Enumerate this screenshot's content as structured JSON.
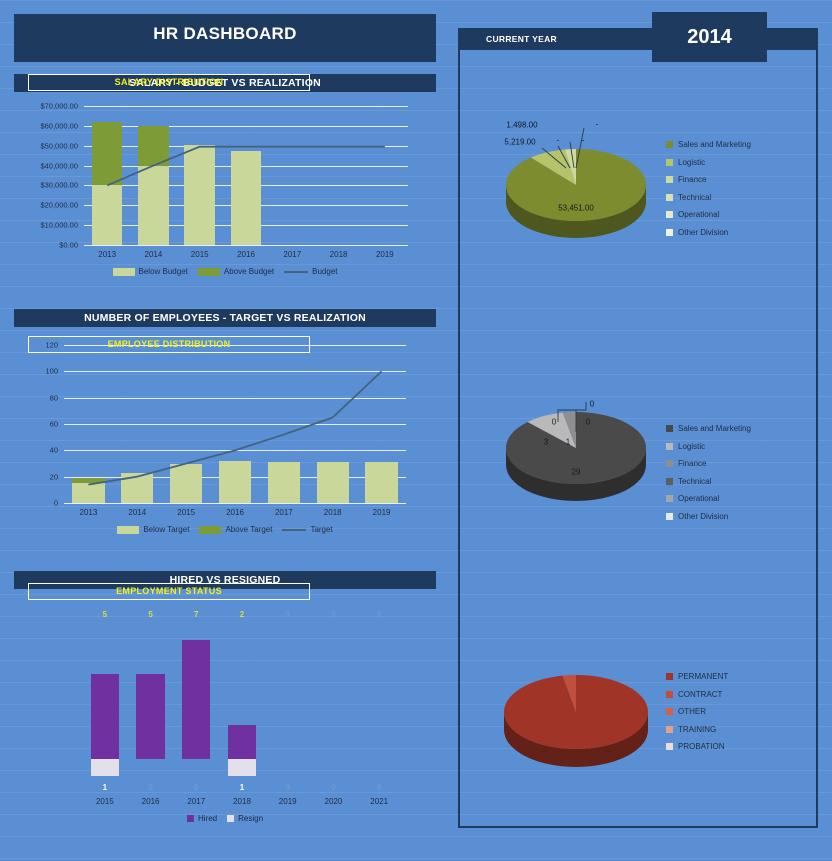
{
  "header": {
    "title": "HR DASHBOARD"
  },
  "current_year": {
    "label": "CURRENT YEAR",
    "value": "2014"
  },
  "sections": {
    "salary_chart_title": "SALARY - BUDGET VS REALIZATION",
    "employees_chart_title": "NUMBER OF EMPLOYEES - TARGET VS REALIZATION",
    "hired_chart_title": "HIRED VS RESIGNED",
    "salary_distribution_title": "SALARY DISTRIBUTION",
    "employee_distribution_title": "EMPLOYEE DISTRIBUTION",
    "employment_status_title": "EMPLOYMENT STATUS"
  },
  "colors": {
    "background": "#5b8fd4",
    "navy": "#1f3a5f",
    "below_budget": "#c9d79b",
    "above_budget": "#7d9b37",
    "budget_line": "#44637f",
    "hired": "#7030a0",
    "resign": "#e3e0ec",
    "label_yellow": "#d7e035",
    "title_yellow": "#f2f21a"
  },
  "chart_data": [
    {
      "type": "bar",
      "title": "SALARY - BUDGET VS REALIZATION",
      "xlabel": "",
      "ylabel": "",
      "categories": [
        "2013",
        "2014",
        "2015",
        "2016",
        "2017",
        "2018",
        "2019"
      ],
      "ylim": [
        0,
        70000
      ],
      "yticks": [
        "$0.00",
        "$10,000.00",
        "$20,000.00",
        "$30,000.00",
        "$40,000.00",
        "$50,000.00",
        "$60,000.00",
        "$70,000.00"
      ],
      "ytick_values": [
        0,
        10000,
        20000,
        30000,
        40000,
        50000,
        60000,
        70000
      ],
      "grid": true,
      "legend": [
        "Below Budget",
        "Above Budget",
        "Budget"
      ],
      "series": [
        {
          "name": "Below Budget",
          "values": [
            30000,
            40000,
            50500,
            47500,
            0,
            0,
            0
          ]
        },
        {
          "name": "Above Budget",
          "values": [
            32000,
            20000,
            0,
            0,
            0,
            0,
            0
          ]
        },
        {
          "name": "Budget",
          "type": "line",
          "values": [
            30000,
            40000,
            49500,
            49500,
            49500,
            49500,
            49500
          ]
        }
      ]
    },
    {
      "type": "bar",
      "title": "NUMBER OF EMPLOYEES - TARGET VS REALIZATION",
      "xlabel": "",
      "ylabel": "",
      "categories": [
        "2013",
        "2014",
        "2015",
        "2016",
        "2017",
        "2018",
        "2019"
      ],
      "ylim": [
        0,
        120
      ],
      "yticks": [
        "0",
        "20",
        "40",
        "60",
        "80",
        "100",
        "120"
      ],
      "ytick_values": [
        0,
        20,
        40,
        60,
        80,
        100,
        120
      ],
      "grid": true,
      "legend": [
        "Below Target",
        "Above Target",
        "Target"
      ],
      "series": [
        {
          "name": "Below Target",
          "values": [
            15,
            23,
            30,
            32,
            31,
            31,
            31
          ]
        },
        {
          "name": "Above Target",
          "values": [
            4,
            0,
            0,
            0,
            0,
            0,
            0
          ]
        },
        {
          "name": "Target",
          "type": "line",
          "values": [
            14,
            20,
            30,
            40,
            52,
            65,
            100
          ]
        }
      ]
    },
    {
      "type": "bar",
      "title": "HIRED VS RESIGNED",
      "xlabel": "",
      "ylabel": "",
      "categories": [
        "2015",
        "2016",
        "2017",
        "2018",
        "2019",
        "2020",
        "2021"
      ],
      "ylim": [
        -2,
        8
      ],
      "grid": false,
      "legend": [
        "Hired",
        "Resign"
      ],
      "series": [
        {
          "name": "Hired",
          "values": [
            5,
            5,
            7,
            2,
            0,
            0,
            0
          ]
        },
        {
          "name": "Resign",
          "values": [
            1,
            0,
            0,
            1,
            0,
            0,
            0
          ]
        }
      ],
      "hired_labels": [
        "5",
        "5",
        "7",
        "2",
        "0",
        "0",
        "0"
      ],
      "resign_labels": [
        "1",
        "0",
        "0",
        "1",
        "0",
        "0",
        "0"
      ]
    },
    {
      "type": "pie",
      "title": "SALARY DISTRIBUTION",
      "labels": [
        "Sales and Marketing",
        "Logistic",
        "Finance",
        "Technical",
        "Operational",
        "Other Division"
      ],
      "values": [
        53451,
        5219,
        1498,
        0,
        0,
        0
      ],
      "value_labels": [
        "53,451.00",
        "5,219.00",
        "1,498.00",
        "-",
        "-",
        "-"
      ],
      "colors": [
        "#7d8c2e",
        "#b5c36a",
        "#cfd99c",
        "#d9e0b2",
        "#e6eacb",
        "#f0f2e4"
      ],
      "legend_position": "right"
    },
    {
      "type": "pie",
      "title": "EMPLOYEE DISTRIBUTION",
      "labels": [
        "Sales and Marketing",
        "Logistic",
        "Finance",
        "Technical",
        "Operational",
        "Other Division"
      ],
      "values": [
        29,
        3,
        1,
        0,
        0,
        0
      ],
      "value_labels": [
        "29",
        "3",
        "1",
        "0",
        "0",
        "0"
      ],
      "colors": [
        "#4a4a4a",
        "#b9b9b9",
        "#8f8f8f",
        "#5e5e5e",
        "#a6a6a6",
        "#e8e8e8"
      ],
      "legend_position": "right"
    },
    {
      "type": "pie",
      "title": "EMPLOYMENT STATUS",
      "labels": [
        "PERMANENT",
        "CONTRACT",
        "OTHER",
        "TRAINING",
        "PROBATION"
      ],
      "values": [
        97,
        3,
        0,
        0,
        0
      ],
      "value_labels": [
        "",
        "",
        "",
        "",
        ""
      ],
      "colors": [
        "#a03527",
        "#c0503c",
        "#d4604a",
        "#e0a18a",
        "#f0ddd2"
      ],
      "legend_position": "right"
    }
  ]
}
